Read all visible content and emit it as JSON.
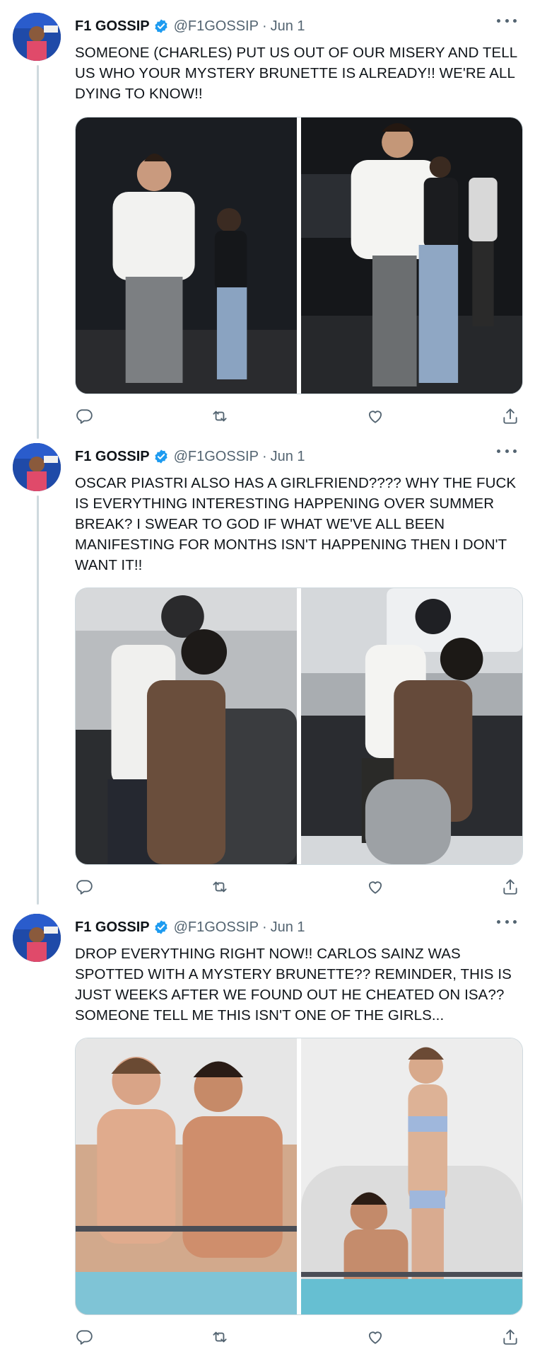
{
  "colors": {
    "verified": "#1d9bf0",
    "muted": "#536471",
    "text": "#0f1419",
    "thread_line": "#cfd9de"
  },
  "icons": {
    "reply": "reply-icon",
    "retweet": "retweet-icon",
    "like": "heart-icon",
    "share": "share-icon",
    "more": "more-icon",
    "verified": "verified-badge-icon"
  },
  "tweets": [
    {
      "name": "F1 GOSSIP",
      "handle": "@F1GOSSIP",
      "separator": "·",
      "date": "Jun 1",
      "text": "SOMEONE (CHARLES) PUT US OUT OF OUR MISERY AND TELL US WHO YOUR MYSTERY BRUNETTE IS ALREADY!! WE'RE ALL DYING TO KNOW!!"
    },
    {
      "name": "F1 GOSSIP",
      "handle": "@F1GOSSIP",
      "separator": "·",
      "date": "Jun 1",
      "text": "OSCAR PIASTRI ALSO HAS A GIRLFRIEND???? WHY THE FUCK IS EVERYTHING INTERESTING HAPPENING OVER SUMMER BREAK? I SWEAR TO GOD IF WHAT WE'VE ALL BEEN MANIFESTING FOR MONTHS ISN'T HAPPENING THEN I DON'T WANT IT!!"
    },
    {
      "name": "F1 GOSSIP",
      "handle": "@F1GOSSIP",
      "separator": "·",
      "date": "Jun 1",
      "text": "DROP EVERYTHING RIGHT NOW!! CARLOS SAINZ WAS SPOTTED WITH A MYSTERY BRUNETTE?? REMINDER, THIS IS JUST WEEKS AFTER WE FOUND OUT HE CHEATED ON ISA?? SOMEONE TELL ME THIS ISN'T ONE OF THE GIRLS..."
    }
  ]
}
